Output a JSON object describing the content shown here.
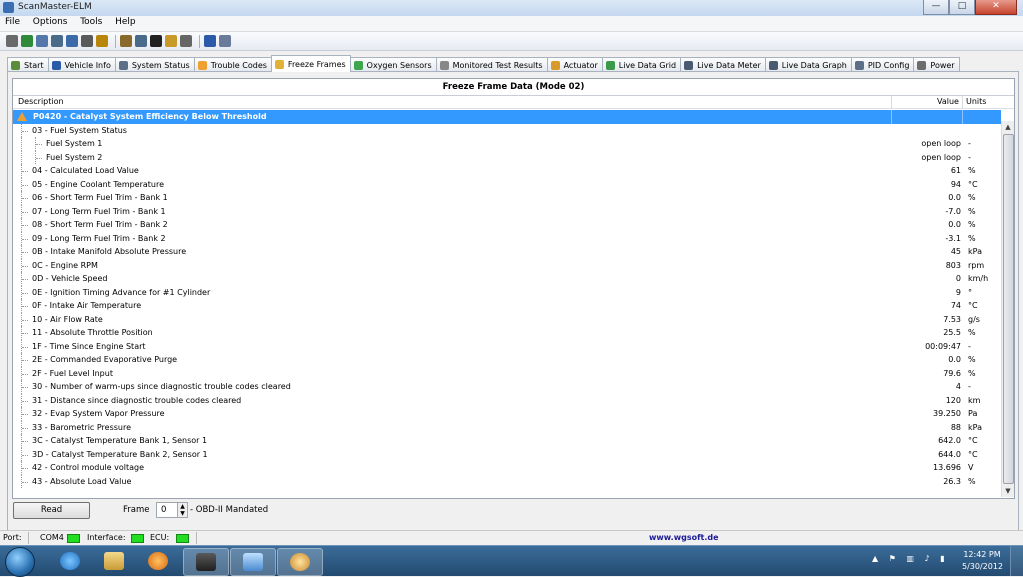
{
  "window": {
    "title": "ScanMaster-ELM",
    "min_label": "—",
    "max_label": "□",
    "close_label": "✕"
  },
  "menu": [
    "File",
    "Options",
    "Tools",
    "Help"
  ],
  "toolbar_icons": [
    "wand-icon",
    "globe-icon",
    "document-icon",
    "grid-icon",
    "chart-icon",
    "table-icon",
    "money-icon",
    "clipboard-icon",
    "chat-icon",
    "terminal-icon",
    "battery-icon",
    "disc-icon",
    "info-icon",
    "book-icon"
  ],
  "tabs": [
    {
      "label": "Start",
      "icon": "start-icon",
      "color": "#5b8c3a"
    },
    {
      "label": "Vehicle Info",
      "icon": "info-icon",
      "color": "#2a5aa8"
    },
    {
      "label": "System Status",
      "icon": "status-icon",
      "color": "#5c6f86"
    },
    {
      "label": "Trouble Codes",
      "icon": "warning-icon",
      "color": "#f0a030"
    },
    {
      "label": "Freeze Frames",
      "icon": "freeze-icon",
      "color": "#e0b23a",
      "active": true
    },
    {
      "label": "Oxygen Sensors",
      "icon": "oxygen-icon",
      "color": "#3ea64c"
    },
    {
      "label": "Monitored Test Results",
      "icon": "gear-icon",
      "color": "#888888"
    },
    {
      "label": "Actuator",
      "icon": "actuator-icon",
      "color": "#d89a2a"
    },
    {
      "label": "Live Data Grid",
      "icon": "grid-icon",
      "color": "#3a9a4a"
    },
    {
      "label": "Live Data Meter",
      "icon": "meter-icon",
      "color": "#4a5a70"
    },
    {
      "label": "Live Data Graph",
      "icon": "graph-icon",
      "color": "#4a5a70"
    },
    {
      "label": "PID Config",
      "icon": "config-icon",
      "color": "#5c6f86"
    },
    {
      "label": "Power",
      "icon": "power-icon",
      "color": "#6d6d6d"
    }
  ],
  "grid": {
    "title": "Freeze Frame Data (Mode 02)",
    "headers": {
      "description": "Description",
      "value": "Value",
      "units": "Units"
    },
    "selected_row": "P0420 - Catalyst System Efficiency Below Threshold",
    "rows": [
      {
        "desc": "03 - Fuel System Status",
        "value": "",
        "unit": "",
        "level": 1
      },
      {
        "desc": "Fuel System 1",
        "value": "open loop",
        "unit": "-",
        "level": 2
      },
      {
        "desc": "Fuel System 2",
        "value": "open loop",
        "unit": "-",
        "level": 2
      },
      {
        "desc": "04 - Calculated Load Value",
        "value": "61",
        "unit": "%",
        "level": 1
      },
      {
        "desc": "05 - Engine Coolant Temperature",
        "value": "94",
        "unit": "°C",
        "level": 1
      },
      {
        "desc": "06 - Short Term Fuel Trim - Bank 1",
        "value": "0.0",
        "unit": "%",
        "level": 1
      },
      {
        "desc": "07 - Long Term Fuel Trim - Bank 1",
        "value": "-7.0",
        "unit": "%",
        "level": 1
      },
      {
        "desc": "08 - Short Term Fuel Trim - Bank 2",
        "value": "0.0",
        "unit": "%",
        "level": 1
      },
      {
        "desc": "09 - Long Term Fuel Trim - Bank 2",
        "value": "-3.1",
        "unit": "%",
        "level": 1
      },
      {
        "desc": "0B - Intake Manifold Absolute Pressure",
        "value": "45",
        "unit": "kPa",
        "level": 1
      },
      {
        "desc": "0C - Engine RPM",
        "value": "803",
        "unit": "rpm",
        "level": 1
      },
      {
        "desc": "0D - Vehicle Speed",
        "value": "0",
        "unit": "km/h",
        "level": 1
      },
      {
        "desc": "0E - Ignition Timing Advance for #1 Cylinder",
        "value": "9",
        "unit": "°",
        "level": 1
      },
      {
        "desc": "0F - Intake Air Temperature",
        "value": "74",
        "unit": "°C",
        "level": 1
      },
      {
        "desc": "10 - Air Flow Rate",
        "value": "7.53",
        "unit": "g/s",
        "level": 1
      },
      {
        "desc": "11 - Absolute Throttle Position",
        "value": "25.5",
        "unit": "%",
        "level": 1
      },
      {
        "desc": "1F - Time Since Engine Start",
        "value": "00:09:47",
        "unit": "-",
        "level": 1
      },
      {
        "desc": "2E - Commanded Evaporative Purge",
        "value": "0.0",
        "unit": "%",
        "level": 1
      },
      {
        "desc": "2F - Fuel Level Input",
        "value": "79.6",
        "unit": "%",
        "level": 1
      },
      {
        "desc": "30 - Number of warm-ups since diagnostic trouble codes cleared",
        "value": "4",
        "unit": "-",
        "level": 1
      },
      {
        "desc": "31 - Distance since diagnostic trouble codes cleared",
        "value": "120",
        "unit": "km",
        "level": 1
      },
      {
        "desc": "32 - Evap System Vapor Pressure",
        "value": "39.250",
        "unit": "Pa",
        "level": 1
      },
      {
        "desc": "33 - Barometric Pressure",
        "value": "88",
        "unit": "kPa",
        "level": 1
      },
      {
        "desc": "3C - Catalyst Temperature Bank 1, Sensor 1",
        "value": "642.0",
        "unit": "°C",
        "level": 1
      },
      {
        "desc": "3D - Catalyst Temperature Bank 2, Sensor 1",
        "value": "644.0",
        "unit": "°C",
        "level": 1
      },
      {
        "desc": "42 - Control module voltage",
        "value": "13.696",
        "unit": "V",
        "level": 1
      },
      {
        "desc": "43 - Absolute Load Value",
        "value": "26.3",
        "unit": "%",
        "level": 1
      }
    ]
  },
  "controls": {
    "read_label": "Read",
    "frame_label": "Frame",
    "frame_value": "0",
    "frame_desc": "- OBD-II Mandated"
  },
  "status": {
    "port_label": "Port:",
    "port_value": "COM4",
    "interface_label": "Interface:",
    "ecu_label": "ECU:",
    "link": "www.wgsoft.de"
  },
  "taskbar": {
    "time": "12:42 PM",
    "date": "5/30/2012"
  }
}
